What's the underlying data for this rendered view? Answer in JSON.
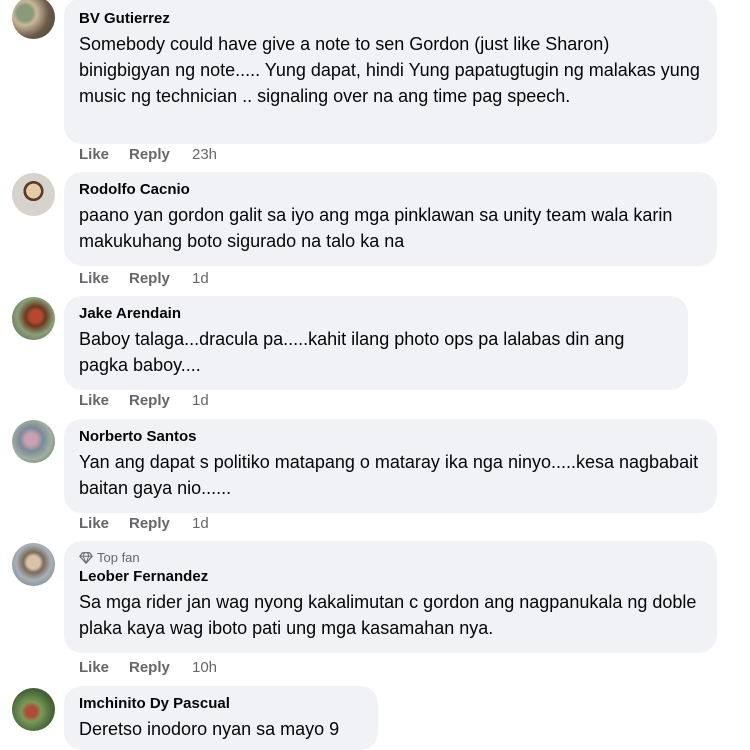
{
  "actions": {
    "like": "Like",
    "reply": "Reply"
  },
  "comments": [
    {
      "author": "BV Gutierrez",
      "text": "Somebody could have give a note to sen Gordon (just like Sharon) binigbigyan ng note..... Yung dapat, hindi Yung papatugtugin ng malakas yung music ng technician .. signaling over na ang time pag speech.",
      "time": "23h"
    },
    {
      "author": "Rodolfo Cacnio",
      "text": "paano yan gordon galit sa iyo ang mga pinklawan sa unity team wala karin makukuhang boto sigurado na talo ka na",
      "time": "1d"
    },
    {
      "author": "Jake Arendain",
      "text": "Baboy talaga...dracula pa.....kahit ilang photo ops pa lalabas din ang pagka baboy....",
      "time": "1d"
    },
    {
      "author": "Norberto Santos",
      "text": "Yan ang dapat s politiko matapang o mataray ika nga ninyo.....kesa nagbabait baitan gaya nio......",
      "time": "1d"
    },
    {
      "author": "Leober Fernandez",
      "badge": "Top fan",
      "text": "Sa mga rider jan wag nyong kakalimutan c gordon ang nagpanukala ng doble plaka kaya wag iboto pati ung mga kasamahan nya.",
      "time": "10h"
    },
    {
      "author": "Imchinito Dy Pascual",
      "text": "Deretso inodoro nyan sa mayo 9"
    }
  ]
}
